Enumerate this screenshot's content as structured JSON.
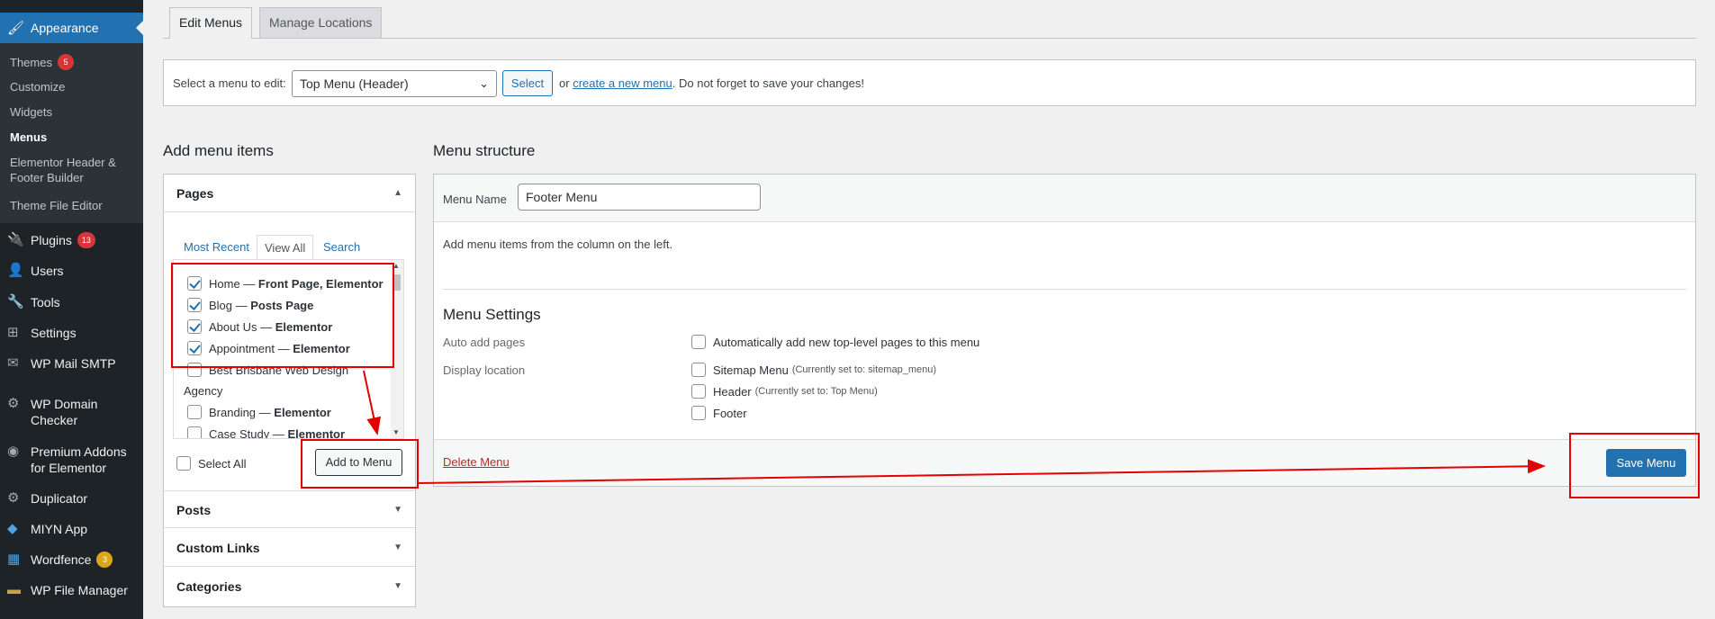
{
  "sidebar": {
    "current": "Appearance",
    "submenu": [
      {
        "label": "Themes",
        "badge": "5"
      },
      {
        "label": "Customize"
      },
      {
        "label": "Widgets"
      },
      {
        "label": "Menus"
      },
      {
        "label": "Elementor Header &",
        "label2": "Footer Builder"
      },
      {
        "label": "Theme File Editor"
      }
    ],
    "items": [
      {
        "label": "Plugins",
        "badge": "13"
      },
      {
        "label": "Users"
      },
      {
        "label": "Tools"
      },
      {
        "label": "Settings"
      },
      {
        "label": "WP Mail SMTP"
      },
      {
        "label": "WP Domain",
        "label2": "Checker"
      },
      {
        "label": "Premium Addons",
        "label2": "for Elementor"
      },
      {
        "label": "Duplicator"
      },
      {
        "label": "MIYN App"
      },
      {
        "label": "Wordfence",
        "badge": "3"
      },
      {
        "label": "WP File Manager"
      }
    ]
  },
  "tabs": {
    "edit": "Edit Menus",
    "manage": "Manage Locations"
  },
  "select_bar": {
    "label": "Select a menu to edit:",
    "selected": "Top Menu (Header)",
    "select_button": "Select",
    "or": "or",
    "create_link": "create a new menu",
    "note": ". Do not forget to save your changes!"
  },
  "add_items": {
    "title": "Add menu items",
    "pages_title": "Pages",
    "subtabs": {
      "recent": "Most Recent",
      "all": "View All",
      "search": "Search"
    },
    "pages": [
      {
        "name": "Home —",
        "tag": "Front Page, Elementor",
        "checked": true
      },
      {
        "name": "Blog —",
        "tag": "Posts Page",
        "checked": true
      },
      {
        "name": "About Us —",
        "tag": "Elementor",
        "checked": true
      },
      {
        "name": "Appointment —",
        "tag": "Elementor",
        "checked": true
      },
      {
        "name": "Best Brisbane Web Design",
        "tag": "",
        "checked": false
      },
      {
        "name": "Agency",
        "tag": "",
        "checked": false
      },
      {
        "name": "Branding —",
        "tag": "Elementor",
        "checked": false
      },
      {
        "name": "Case Study —",
        "tag": "Elementor",
        "checked": false
      }
    ],
    "select_all": "Select All",
    "add_button": "Add to Menu",
    "posts": "Posts",
    "custom_links": "Custom Links",
    "categories": "Categories"
  },
  "structure": {
    "title": "Menu structure",
    "menu_name_label": "Menu Name",
    "menu_name_value": "Footer Menu",
    "instructions": "Add menu items from the column on the left.",
    "settings_title": "Menu Settings",
    "auto_add_label": "Auto add pages",
    "auto_add_option": "Automatically add new top-level pages to this menu",
    "display_location_label": "Display location",
    "locations": [
      {
        "name": "Sitemap Menu",
        "note": "(Currently set to: sitemap_menu)"
      },
      {
        "name": "Header",
        "note": "(Currently set to: Top Menu)"
      },
      {
        "name": "Footer",
        "note": ""
      }
    ],
    "delete_link": "Delete Menu",
    "save_button": "Save Menu"
  },
  "colors": {
    "accent": "#2271b1",
    "annotation": "#e50000",
    "sidebar": "#1d2327"
  }
}
